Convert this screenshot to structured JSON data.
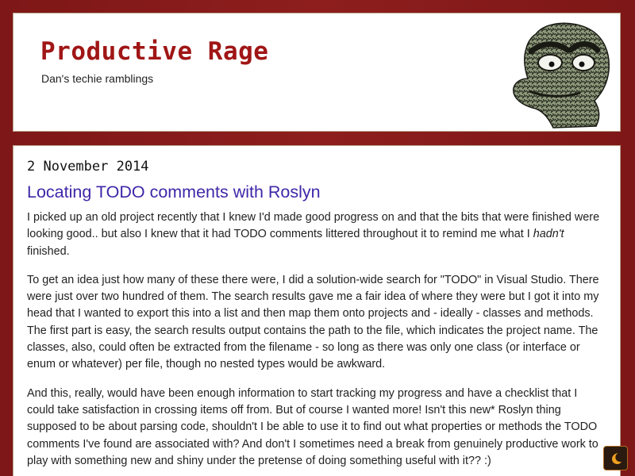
{
  "header": {
    "title": "Productive Rage",
    "tagline": "Dan's techie ramblings"
  },
  "post": {
    "date": "2 November 2014",
    "title": "Locating TODO comments with Roslyn",
    "p1_a": "I picked up an old project recently that I knew I'd made good progress on and that the bits that were finished were looking good.. but also I knew that it had TODO comments littered throughout it to remind me what I ",
    "p1_em": "hadn't",
    "p1_b": " finished.",
    "p2": "To get an idea just how many of these there were, I did a solution-wide search for \"TODO\" in Visual Studio. There were just over two hundred of them. The search results gave me a fair idea of where they were but I got it into my head that I wanted to export this into a list and then map them onto projects and - ideally - classes and methods. The first part is easy, the search results output contains the path to the file, which indicates the project name. The classes, also, could often be extracted from the filename - so long as there was only one class (or interface or enum or whatever) per file, though no nested types would be awkward.",
    "p3": "And this, really, would have been enough information to start tracking my progress and have a checklist that I could take satisfaction in crossing items off from. But of course I wanted more! Isn't this new* Roslyn thing supposed to be about parsing code, shouldn't I be able to use it to find out what properties or methods the TODO comments I've found are associated with? And don't I sometimes need a break from genuinely productive work to play with something new and shiny under the pretense of doing something useful with it?? :)"
  },
  "icons": {
    "mascot": "grouch-mascot-icon",
    "theme_toggle": "moon-icon"
  },
  "colors": {
    "background": "#8a1c1c",
    "title": "#a01616",
    "link": "#3f27a8"
  }
}
